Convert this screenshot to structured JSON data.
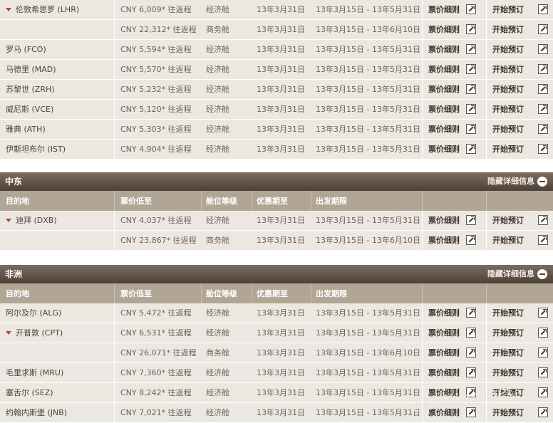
{
  "common": {
    "fare_rules_label": "票价细则",
    "book_label": "开始预订",
    "hide_details_label": "隐藏详细信息"
  },
  "columns": {
    "destination": "目的地",
    "price": "票价低至",
    "class": "舱位等级",
    "valid": "优惠期至",
    "travel": "出发期限"
  },
  "europe_rows": [
    {
      "dest": "伦敦希思罗 (LHR)",
      "expanded": true,
      "price": "CNY 6,009* 往返程",
      "class": "经济舱",
      "valid": "13年3月31日",
      "travel": "13年3月15日 - 13年5月31日"
    },
    {
      "dest": "",
      "price": "CNY 22,312* 往返程",
      "class": "商务舱",
      "valid": "13年3月31日",
      "travel": "13年3月15日 - 13年6月10日"
    },
    {
      "dest": "罗马 (FCO)",
      "price": "CNY 5,594* 往返程",
      "class": "经济舱",
      "valid": "13年3月31日",
      "travel": "13年3月15日 - 13年5月31日"
    },
    {
      "dest": "马德里 (MAD)",
      "price": "CNY 5,570* 往返程",
      "class": "经济舱",
      "valid": "13年3月31日",
      "travel": "13年3月15日 - 13年5月31日"
    },
    {
      "dest": "苏黎世 (ZRH)",
      "price": "CNY 5,232* 往返程",
      "class": "经济舱",
      "valid": "13年3月31日",
      "travel": "13年3月15日 - 13年5月31日"
    },
    {
      "dest": "威尼斯 (VCE)",
      "price": "CNY 5,120* 往返程",
      "class": "经济舱",
      "valid": "13年3月31日",
      "travel": "13年3月15日 - 13年5月31日"
    },
    {
      "dest": "雅典 (ATH)",
      "price": "CNY 5,303* 往返程",
      "class": "经济舱",
      "valid": "13年3月31日",
      "travel": "13年3月15日 - 13年5月31日"
    },
    {
      "dest": "伊斯坦布尔 (IST)",
      "price": "CNY 4,904* 往返程",
      "class": "经济舱",
      "valid": "13年3月31日",
      "travel": "13年3月15日 - 13年5月31日"
    }
  ],
  "middle_east": {
    "title": "中东",
    "rows": [
      {
        "dest": "迪拜 (DXB)",
        "expanded": true,
        "price": "CNY 4,037* 往返程",
        "class": "经济舱",
        "valid": "13年3月31日",
        "travel": "13年3月15日 - 13年5月31日"
      },
      {
        "dest": "",
        "price": "CNY 23,867* 往返程",
        "class": "商务舱",
        "valid": "13年3月31日",
        "travel": "13年3月15日 - 13年6月10日"
      }
    ]
  },
  "africa": {
    "title": "非洲",
    "rows": [
      {
        "dest": "阿尔及尔 (ALG)",
        "price": "CNY 5,472* 往返程",
        "class": "经济舱",
        "valid": "13年3月31日",
        "travel": "13年3月15日 - 13年5月31日"
      },
      {
        "dest": "开普敦 (CPT)",
        "expanded": true,
        "price": "CNY 6,531* 往返程",
        "class": "经济舱",
        "valid": "13年3月31日",
        "travel": "13年3月15日 - 13年5月31日"
      },
      {
        "dest": "",
        "price": "CNY 26,071* 往返程",
        "class": "商务舱",
        "valid": "13年3月31日",
        "travel": "13年3月15日 - 13年6月10日"
      },
      {
        "dest": "毛里求斯 (MRU)",
        "price": "CNY 7,360* 往返程",
        "class": "经济舱",
        "valid": "13年3月31日",
        "travel": "13年3月15日 - 13年5月31日"
      },
      {
        "dest": "塞舌尔 (SEZ)",
        "price": "CNY 8,242* 往返程",
        "class": "经济舱",
        "valid": "13年3月31日",
        "travel": "13年3月15日 - 13年5月31日"
      },
      {
        "dest": "约翰内斯堡 (JNB)",
        "price": "CNY 7,021* 往返程",
        "class": "经济舱",
        "valid": "13年3月31日",
        "travel": "13年3月15日 - 13年5月31日"
      }
    ]
  },
  "watermark": "eLvXing.net"
}
